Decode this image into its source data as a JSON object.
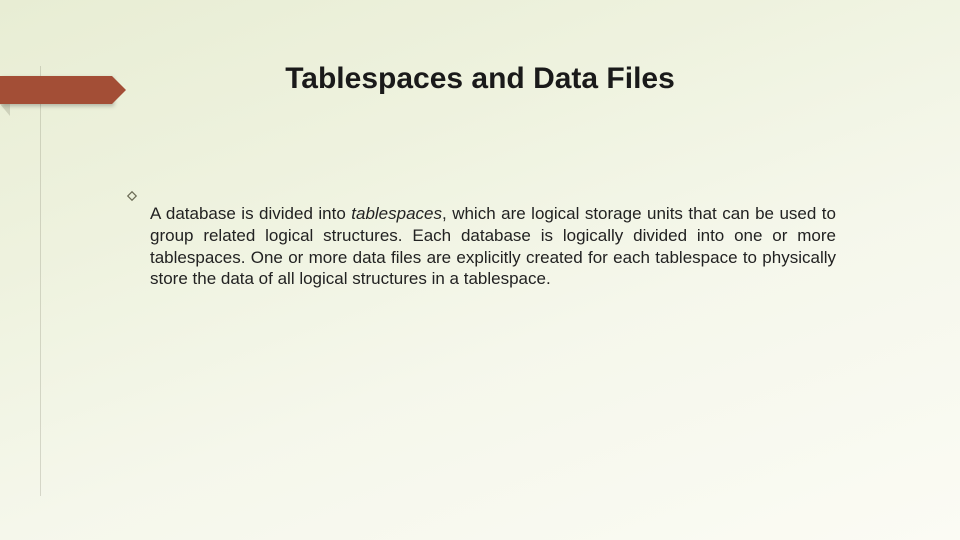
{
  "slide": {
    "title": "Tablespaces and Data Files",
    "bullet": {
      "text_before": "A database is divided into ",
      "italic_word": "tablespaces",
      "text_after": ", which are logical storage units that can be used to group related logical structures. Each database is logically divided into one or more tablespaces. One or more data files are explicitly created for each tablespace to physically store the data of all logical structures in a tablespace."
    }
  }
}
